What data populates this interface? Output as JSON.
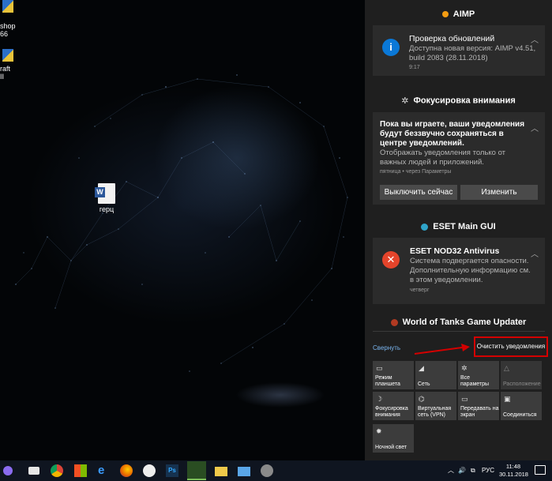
{
  "desktop": {
    "icons": [
      {
        "label": "shop",
        "sub": "66",
        "icon": "photoshop-icon"
      },
      {
        "label": "raft II",
        "icon": "shield-icon"
      },
      {
        "label": "герц",
        "icon": "word-document-icon"
      }
    ]
  },
  "action_center": {
    "groups": [
      {
        "app": "AIMP",
        "title": "Проверка обновлений",
        "body": "Доступна новая версия: AIMP v4.51, build 2083 (28.11.2018)",
        "time": "9:17",
        "icon": "info-icon"
      },
      {
        "app": "Фокусировка внимания",
        "title": "Пока вы играете, ваши уведомления будут беззвучно сохраняться в центре уведомлений.",
        "body": "Отображать уведомления только от важных людей и приложений.",
        "time": "пятница • через Параметры",
        "buttons": [
          "Выключить сейчас",
          "Изменить"
        ]
      },
      {
        "app": "ESET Main GUI",
        "title": "ESET NOD32 Antivirus",
        "body": "Система подвергается опасности. Дополнительную информацию см. в этом уведомлении.",
        "time": "четверг",
        "icon": "error-icon"
      },
      {
        "app": "World of Tanks Game Updater"
      }
    ],
    "collapse_label": "Свернуть",
    "clear_label": "Очистить уведомления",
    "quick_actions": [
      {
        "label": "Режим планшета",
        "icon": "tablet-mode-icon",
        "enabled": true
      },
      {
        "label": "Сеть",
        "icon": "network-icon",
        "enabled": true
      },
      {
        "label": "Все параметры",
        "icon": "gear-icon",
        "enabled": true
      },
      {
        "label": "Расположение",
        "icon": "location-icon",
        "enabled": false
      },
      {
        "label": "Фокусировка внимания",
        "icon": "moon-icon",
        "enabled": true
      },
      {
        "label": "Виртуальная сеть (VPN)",
        "icon": "vpn-icon",
        "enabled": true
      },
      {
        "label": "Передавать на экран",
        "icon": "project-icon",
        "enabled": true
      },
      {
        "label": "Соединиться",
        "icon": "connect-icon",
        "enabled": true
      },
      {
        "label": "Ночной свет",
        "icon": "night-light-icon",
        "enabled": true
      }
    ]
  },
  "taskbar": {
    "language": "РУС",
    "time": "11:48",
    "date": "30.11.2018",
    "accent": "#cc0000"
  }
}
